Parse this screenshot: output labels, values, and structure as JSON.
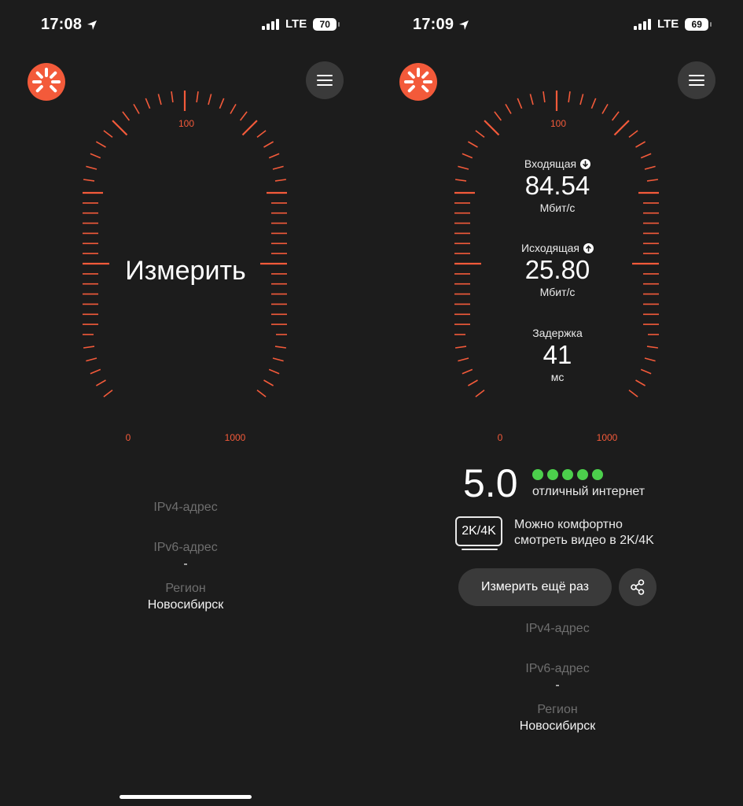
{
  "colors": {
    "accent": "#f35a3a",
    "background": "#1c1c1c",
    "good": "#4ccf4c"
  },
  "left": {
    "status": {
      "time": "17:08",
      "network": "LTE",
      "battery": "70"
    },
    "gauge": {
      "tick_min": "0",
      "tick_mid": "100",
      "tick_max": "1000"
    },
    "measure_label": "Измерить",
    "info": {
      "ipv4_label": "IPv4-адрес",
      "ipv6_label": "IPv6-адрес",
      "ipv6_value": "-",
      "region_label": "Регион",
      "region_value": "Новосибирск"
    }
  },
  "right": {
    "status": {
      "time": "17:09",
      "network": "LTE",
      "battery": "69"
    },
    "gauge": {
      "tick_min": "0",
      "tick_mid": "100",
      "tick_max": "1000"
    },
    "download": {
      "label": "Входящая",
      "value": "84.54",
      "unit": "Мбит/с"
    },
    "upload": {
      "label": "Исходящая",
      "value": "25.80",
      "unit": "Мбит/с"
    },
    "latency": {
      "label": "Задержка",
      "value": "41",
      "unit": "мс"
    },
    "rating": {
      "score": "5.0",
      "dots": 5,
      "text": "отличный интернет"
    },
    "quality": {
      "badge": "2K/4K",
      "text": "Можно комфортно смотреть видео в 2K/4K"
    },
    "again_button": "Измерить ещё раз",
    "info": {
      "ipv4_label": "IPv4-адрес",
      "ipv6_label": "IPv6-адрес",
      "ipv6_value": "-",
      "region_label": "Регион",
      "region_value": "Новосибирск"
    }
  }
}
